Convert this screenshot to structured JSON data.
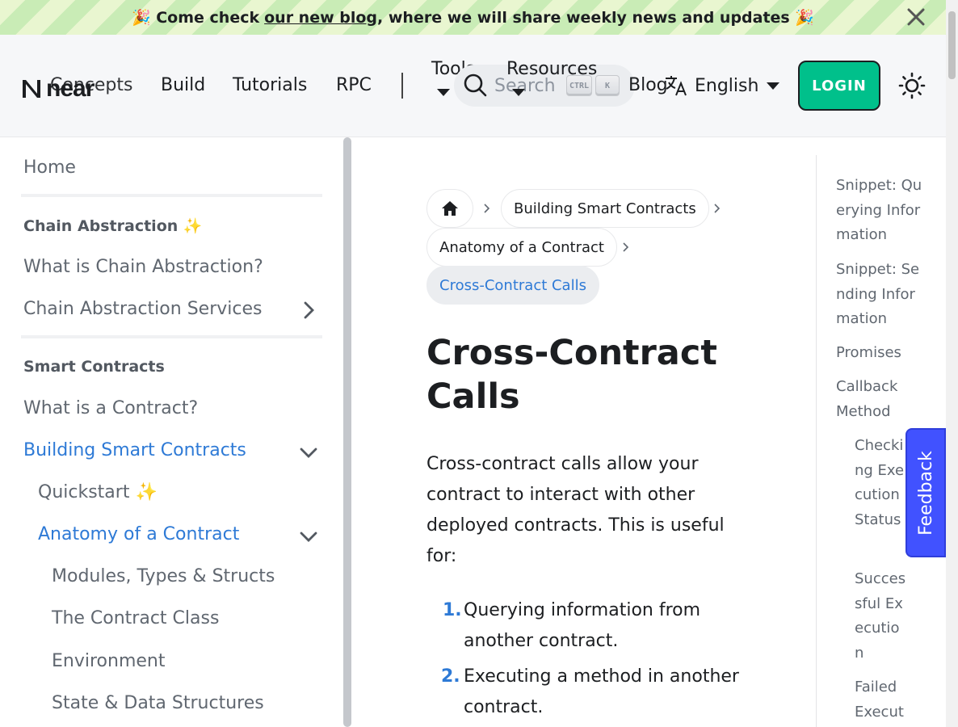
{
  "announcement": {
    "emoji_left": "🎉",
    "text_before": "Come check ",
    "link_text": "our new blog",
    "text_after": ", where we will share weekly news and updates",
    "emoji_right": "🎉"
  },
  "navbar": {
    "logo_text": "near",
    "items": [
      "Concepts",
      "Build",
      "Tutorials",
      "RPC"
    ],
    "tools_label": "Tools",
    "resources_label": "Resources",
    "blog_label": "Blog",
    "search_placeholder": "Search",
    "kbd_ctrl": "CTRL",
    "kbd_k": "K",
    "language": "English",
    "login_label": "LOGIN"
  },
  "sidebar": {
    "home": "Home",
    "categories": {
      "chain_abstraction": "Chain Abstraction ✨",
      "smart_contracts": "Smart Contracts"
    },
    "items": {
      "what_is_chain_abstraction": "What is Chain Abstraction?",
      "chain_abstraction_services": "Chain Abstraction Services",
      "what_is_contract": "What is a Contract?",
      "building_smart_contracts": "Building Smart Contracts",
      "quickstart": "Quickstart ✨",
      "anatomy": "Anatomy of a Contract",
      "modules": "Modules, Types & Structs",
      "contract_class": "The Contract Class",
      "environment": "Environment",
      "state": "State & Data Structures"
    }
  },
  "breadcrumbs": [
    "Building Smart Contracts",
    "Anatomy of a Contract",
    "Cross-Contract Calls"
  ],
  "content": {
    "title": "Cross-Contract Calls",
    "intro": "Cross-contract calls allow your contract to interact with other deployed contracts. This is useful for:",
    "list": [
      {
        "num": "1.",
        "text": "Querying information from another contract."
      },
      {
        "num": "2.",
        "text": "Executing a method in another contract."
      }
    ]
  },
  "toc": [
    "Snippet: Querying Information",
    "Snippet: Sending Information",
    "Promises",
    "Callback Method",
    "Checking Execution Status",
    "Successful Execution",
    "Failed Executi"
  ],
  "feedback_label": "Feedback",
  "colors": {
    "accent": "#2e7ad6",
    "login": "#00c08b",
    "feedback": "#4152ff"
  }
}
